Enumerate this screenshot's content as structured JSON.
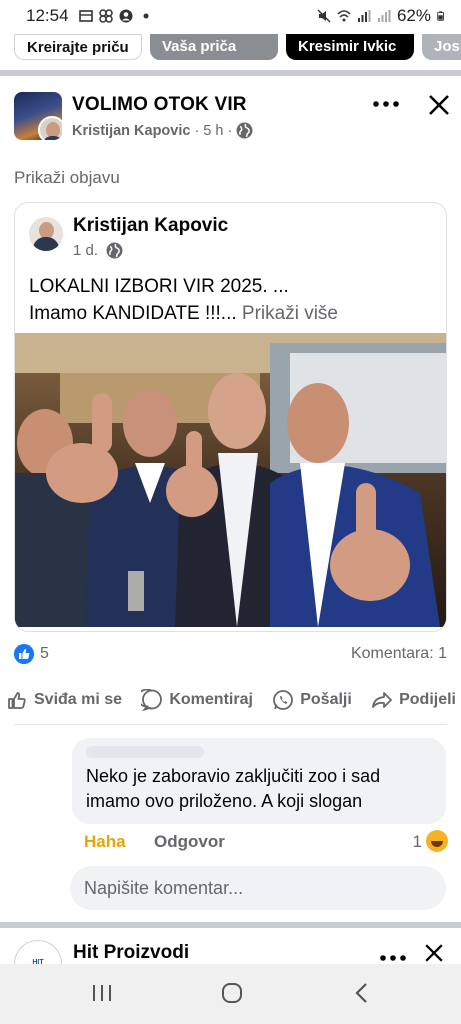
{
  "status_bar": {
    "time": "12:54",
    "battery": "62%"
  },
  "stories": [
    "Kreirajte priču",
    "Vaša priča",
    "Kresimir Ivkic",
    "Josi"
  ],
  "post": {
    "group_name": "VOLIMO OTOK VIR",
    "author": "Kristijan Kapovic",
    "time": "5 h",
    "show_post": "Prikaži objavu",
    "shared": {
      "author": "Kristijan Kapovic",
      "time": "1 d.",
      "text_line1": "LOKALNI IZBORI VIR 2025. ...",
      "text_line2": "Imamo KANDIDATE !!!...",
      "see_more": "Prikaži više"
    },
    "reactions": {
      "count": "5",
      "comments": "Komentara: 1"
    },
    "actions": {
      "like": "Sviđa mi se",
      "comment": "Komentiraj",
      "send": "Pošalji",
      "share": "Podijeli"
    },
    "comment": {
      "text_line1": "Neko je zaboravio zaključiti zoo i sad",
      "text_line2": "imamo ovo priloženo. A koji slogan",
      "haha": "Haha",
      "reply": "Odgovor",
      "reaction_count": "1"
    },
    "write_comment_placeholder": "Napišite komentar..."
  },
  "next_post": {
    "name": "Hit Proizvodi",
    "avatar_text": "HIT PROIZVODI"
  },
  "colors": {
    "accent": "#1877f2",
    "secondary_text": "#65676b",
    "haha": "#e5a50a"
  }
}
